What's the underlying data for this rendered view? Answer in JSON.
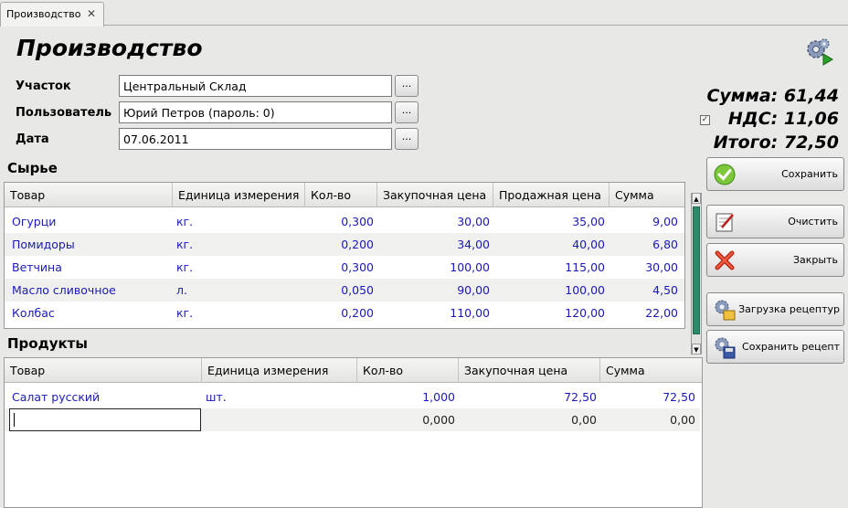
{
  "tab": {
    "label": "Производство",
    "close_glyph": "✕"
  },
  "page_title": "Производство",
  "fields": {
    "area": {
      "label": "Участок",
      "value": "Центральный Склад"
    },
    "user": {
      "label": "Пользователь",
      "value": "Юрий Петров (пароль: 0)"
    },
    "date": {
      "label": "Дата",
      "value": "07.06.2011"
    },
    "browse_label": "..."
  },
  "raw_section": {
    "title": "Сырье",
    "columns": [
      "Товар",
      "Единица измерения",
      "Кол-во",
      "Закупочная цена",
      "Продажная цена",
      "Сумма"
    ],
    "rows": [
      [
        "Огурци",
        "кг.",
        "0,300",
        "30,00",
        "35,00",
        "9,00"
      ],
      [
        "Помидоры",
        "кг.",
        "0,200",
        "34,00",
        "40,00",
        "6,80"
      ],
      [
        "Ветчина",
        "кг.",
        "0,300",
        "100,00",
        "115,00",
        "30,00"
      ],
      [
        "Масло сливочное",
        "л.",
        "0,050",
        "90,00",
        "100,00",
        "4,50"
      ],
      [
        "Колбас",
        "кг.",
        "0,200",
        "110,00",
        "120,00",
        "22,00"
      ]
    ]
  },
  "products_section": {
    "title": "Продукты",
    "columns": [
      "Товар",
      "Единица измерения",
      "Кол-во",
      "Закупочная цена",
      "Сумма"
    ],
    "rows": [
      [
        "Салат русский",
        "шт.",
        "1,000",
        "72,50",
        "72,50"
      ]
    ],
    "new_row": [
      "",
      "",
      "0,000",
      "0,00",
      "0,00"
    ]
  },
  "totals": {
    "sum": "Сумма:  61,44",
    "vat": "НДС:  11,06",
    "total": "Итого:  72,50",
    "vat_checked": true
  },
  "buttons": {
    "save": "Сохранить",
    "clear": "Очистить",
    "close": "Закрыть",
    "load_recipe": "Загрузка рецептур",
    "save_recipe": "Сохранить рецепт"
  },
  "colors": {
    "link_text": "#1a1ab8",
    "row_alt": "#f0f0ee",
    "scroll_thumb": "#2c8a6a"
  },
  "icons": [
    "gears-run-icon",
    "checkmark-icon",
    "edit-clear-icon",
    "close-x-icon",
    "gears-load-icon",
    "gears-save-icon",
    "vat-checkbox-icon"
  ]
}
